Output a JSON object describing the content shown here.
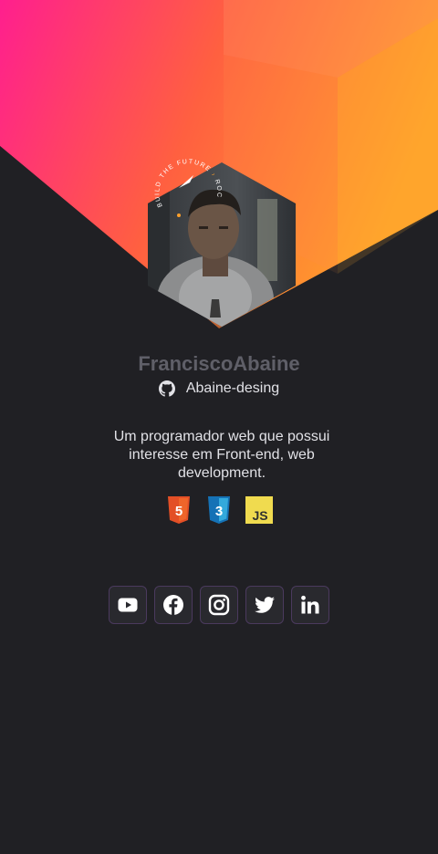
{
  "profile": {
    "name": "FranciscoAbaine",
    "github_user": "Abaine-desing",
    "bio": "Um programador web que possui interesse em Front-end, web development.",
    "badge_top": "BUILD THE FUTURE",
    "badge_side": "ROCKETSEAT"
  },
  "techs": [
    {
      "name": "html5",
      "icon": "html5-icon",
      "color": "#e34f26",
      "label": "5"
    },
    {
      "name": "css3",
      "icon": "css3-icon",
      "color": "#1572b6",
      "label": "3"
    },
    {
      "name": "javascript",
      "icon": "javascript-icon",
      "color": "#f0db4f",
      "label": "JS"
    }
  ],
  "socials": [
    {
      "name": "youtube",
      "icon": "youtube-icon"
    },
    {
      "name": "facebook",
      "icon": "facebook-icon"
    },
    {
      "name": "instagram",
      "icon": "instagram-icon"
    },
    {
      "name": "twitter",
      "icon": "twitter-icon"
    },
    {
      "name": "linkedin",
      "icon": "linkedin-icon"
    }
  ],
  "colors": {
    "background": "#202024",
    "gradient_start": "#ff1f8e",
    "gradient_mid": "#ff5a4e",
    "gradient_end": "#ffa02a",
    "name_text": "#5f5f68",
    "social_border": "#4b3a5e"
  }
}
